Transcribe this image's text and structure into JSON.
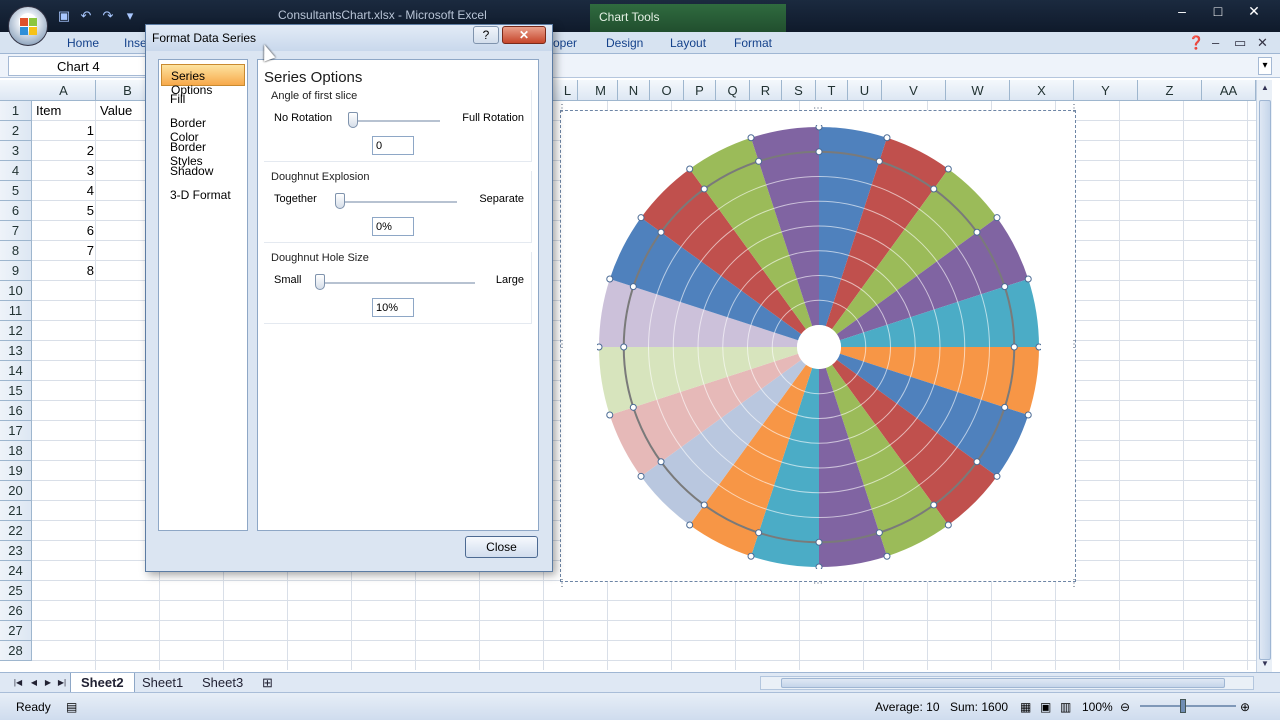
{
  "window": {
    "doc_title": "ConsultantsChart.xlsx - Microsoft Excel",
    "contextual_tab_group": "Chart Tools",
    "controls": [
      "–",
      "□",
      "✕"
    ]
  },
  "ribbon": {
    "tabs": [
      "Home",
      "Inse",
      "oper",
      "Design",
      "Layout",
      "Format"
    ]
  },
  "name_box": "Chart 4",
  "columns": [
    "A",
    "B",
    "L",
    "M",
    "N",
    "O",
    "P",
    "Q",
    "R",
    "S",
    "T",
    "U",
    "V",
    "W",
    "X",
    "Y",
    "Z",
    "AA"
  ],
  "rows": [
    "1",
    "2",
    "3",
    "4",
    "5",
    "6",
    "7",
    "8",
    "9",
    "10",
    "11",
    "12",
    "13",
    "14",
    "15",
    "16",
    "17",
    "18",
    "19",
    "20",
    "21",
    "22",
    "23",
    "24",
    "25",
    "26",
    "27",
    "28"
  ],
  "table": {
    "headers": [
      "Item",
      "Value"
    ],
    "items": [
      "1",
      "2",
      "3",
      "4",
      "5",
      "6",
      "7",
      "8"
    ]
  },
  "sheets": {
    "tabs": [
      "Sheet2",
      "Sheet1",
      "Sheet3"
    ],
    "active": "Sheet2"
  },
  "status": {
    "ready": "Ready",
    "average": "Average: 10",
    "sum": "Sum: 1600",
    "zoom": "100%"
  },
  "dialog": {
    "title": "Format Data Series",
    "help": "?",
    "nav": [
      "Series Options",
      "Fill",
      "Border Color",
      "Border Styles",
      "Shadow",
      "3-D Format"
    ],
    "panel_heading": "Series Options",
    "angle": {
      "label": "Angle of first slice",
      "left": "No Rotation",
      "right": "Full Rotation",
      "value": "0",
      "fraction": 0.0
    },
    "explosion": {
      "label": "Doughnut Explosion",
      "left": "Together",
      "right": "Separate",
      "value": "0%",
      "fraction": 0.0
    },
    "hole": {
      "label": "Doughnut Hole Size",
      "left": "Small",
      "right": "Large",
      "value": "10%",
      "fraction": 0.0
    },
    "close_label": "Close"
  },
  "chart_data": {
    "type": "doughnut",
    "rings": 8,
    "slice_count": 20,
    "hole_size_percent": 10,
    "explosion_percent": 0,
    "first_slice_angle": 0,
    "slice_colors": [
      "#4f81bd",
      "#c0504d",
      "#9bbb59",
      "#8064a2",
      "#4bacc6",
      "#f79646",
      "#4f81bd",
      "#c0504d",
      "#9bbb59",
      "#8064a2",
      "#4bacc6",
      "#f79646",
      "#b9c7df",
      "#e6b9b8",
      "#d7e4bd",
      "#ccc1da",
      "#4f81bd",
      "#c0504d",
      "#9bbb59",
      "#8064a2"
    ]
  }
}
